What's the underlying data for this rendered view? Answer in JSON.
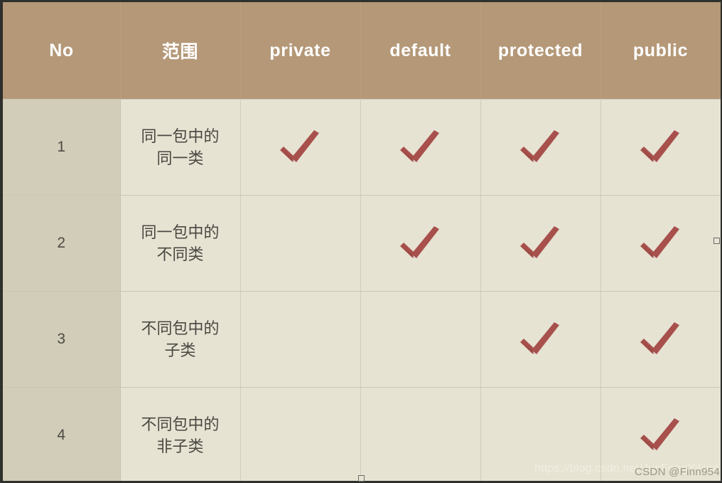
{
  "table": {
    "columns": [
      {
        "key": "no",
        "label": "No",
        "align": "center"
      },
      {
        "key": "scope",
        "label": "范围",
        "align": "center"
      },
      {
        "key": "private",
        "label": "private",
        "align": "center"
      },
      {
        "key": "default",
        "label": "default",
        "align": "center"
      },
      {
        "key": "protected",
        "label": "protected",
        "align": "center"
      },
      {
        "key": "public",
        "label": "public",
        "align": "center"
      }
    ],
    "rows": [
      {
        "no": "1",
        "scope": "同一包中的同一类",
        "private": "✔",
        "default": "✔",
        "protected": "✔",
        "public": "✔"
      },
      {
        "no": "2",
        "scope": "同一包中的不同类",
        "private": "",
        "default": "✔",
        "protected": "✔",
        "public": "✔"
      },
      {
        "no": "3",
        "scope": "不同包中的子类",
        "private": "",
        "default": "",
        "protected": "✔",
        "public": "✔"
      },
      {
        "no": "4",
        "scope": "不同包中的非子类",
        "private": "",
        "default": "",
        "protected": "",
        "public": "✔"
      }
    ]
  },
  "watermarks": {
    "url": "https://blog.csdn.net/JunFengYiHan",
    "author": "CSDN @Finn954"
  },
  "colors": {
    "header_background": "#b49878",
    "header_text": "#ffffff",
    "index_cell_background": "#d2cdb8",
    "cell_background": "#e6e3d3",
    "cell_border": "#c9c6b4",
    "cell_text": "#4a4741",
    "check_mark": "#a8504c",
    "page_backdrop": "#2f2f2d"
  },
  "icons": {
    "check": "check-mark-icon"
  }
}
